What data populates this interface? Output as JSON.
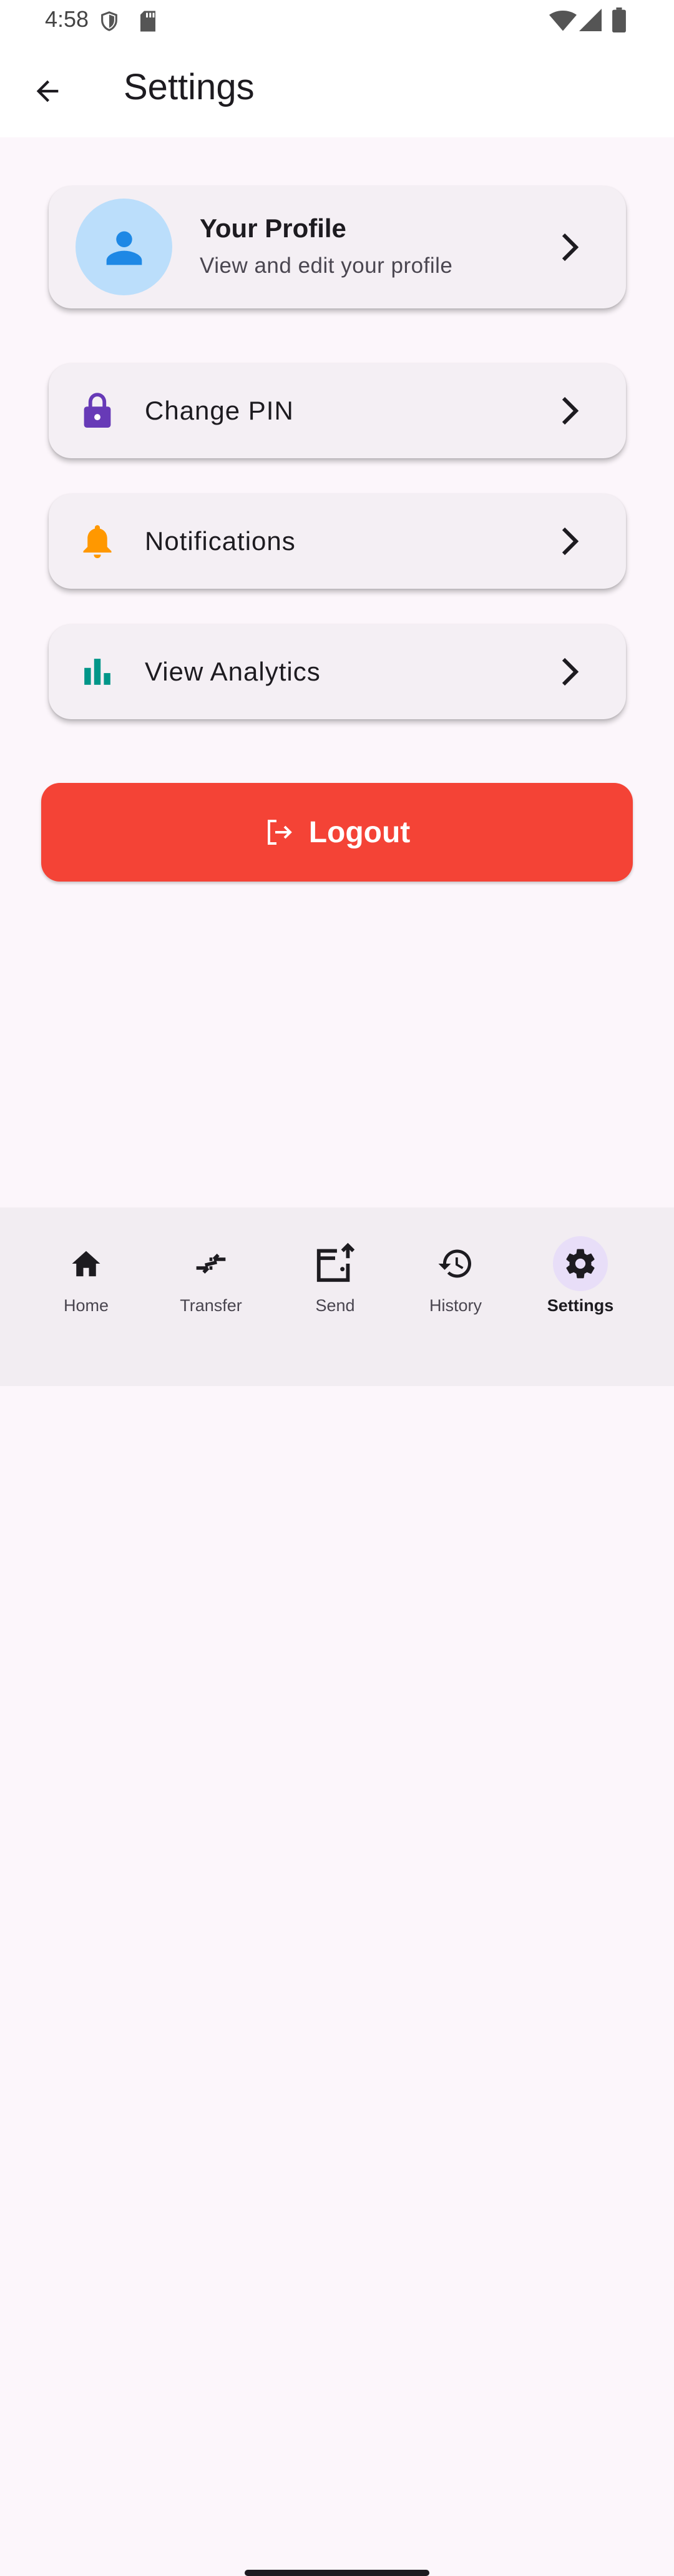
{
  "status_bar": {
    "time": "4:58",
    "icons": [
      "shield-icon",
      "sd-card-icon",
      "wifi-icon",
      "signal-icon",
      "battery-icon"
    ]
  },
  "app_bar": {
    "title": "Settings",
    "back_icon": "arrow-back-icon"
  },
  "profile_card": {
    "title": "Your Profile",
    "subtitle": "View and edit your profile",
    "avatar_icon": "person-icon"
  },
  "settings_items": [
    {
      "label": "Change PIN",
      "icon": "lock-icon",
      "icon_color": "#673ab7"
    },
    {
      "label": "Notifications",
      "icon": "bell-icon",
      "icon_color": "#ff9800"
    },
    {
      "label": "View Analytics",
      "icon": "bar-chart-icon",
      "icon_color": "#009688"
    }
  ],
  "logout": {
    "label": "Logout",
    "color": "#f44336"
  },
  "bottom_nav": {
    "items": [
      {
        "label": "Home",
        "icon": "home-icon"
      },
      {
        "label": "Transfer",
        "icon": "transfer-icon"
      },
      {
        "label": "Send",
        "icon": "send-icon"
      },
      {
        "label": "History",
        "icon": "history-icon"
      },
      {
        "label": "Settings",
        "icon": "gear-icon",
        "active": true
      }
    ]
  }
}
